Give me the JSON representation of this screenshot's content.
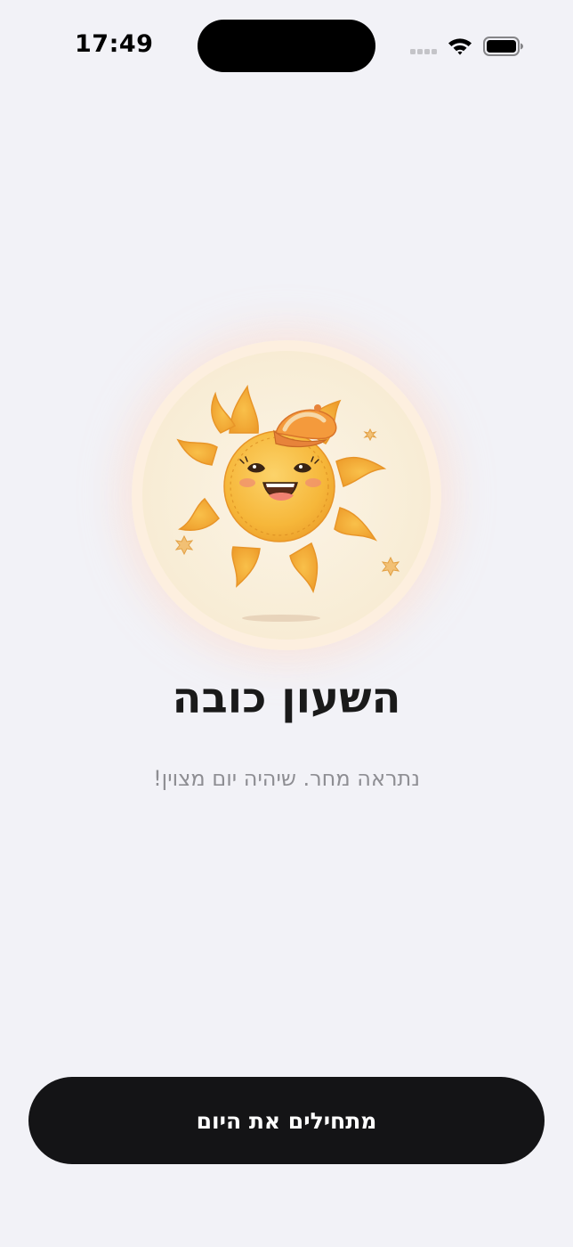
{
  "status_bar": {
    "time": "17:49",
    "icons": [
      "signal-icon",
      "wifi-icon",
      "battery-icon"
    ]
  },
  "hero": {
    "illustration": "sun-mascot-illustration"
  },
  "welcome": {
    "title": "השעון כובה",
    "subtitle": "נתראה מחר. שיהיה יום מצוין!"
  },
  "actions": {
    "start_label": "מתחילים את היום"
  },
  "colors": {
    "background": "#f2f2f7",
    "button": "#141416",
    "title": "#1a1a1a",
    "subtitle": "#8e8e93",
    "sun": "#f5b236"
  }
}
